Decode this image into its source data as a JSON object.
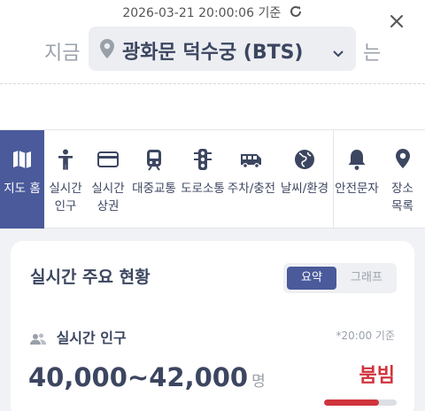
{
  "header": {
    "timestamp": "2026-03-21 20:00:06 기준",
    "location_prefix": "지금",
    "location_name": "광화문 덕수궁 (BTS)",
    "location_suffix": "는"
  },
  "nav": {
    "items": [
      {
        "label": "지도 홈",
        "icon": "map-icon",
        "active": true
      },
      {
        "label": "실시간\n인구",
        "icon": "person-icon"
      },
      {
        "label": "실시간\n상권",
        "icon": "credit-card-icon"
      },
      {
        "label": "대중교통",
        "icon": "subway-icon"
      },
      {
        "label": "도로소통",
        "icon": "traffic-light-icon"
      },
      {
        "label": "주차/충전",
        "icon": "bus-icon"
      },
      {
        "label": "날씨/환경",
        "icon": "globe-icon"
      },
      {
        "label": "안전문자",
        "icon": "bell-icon"
      },
      {
        "label": "장소\n목록",
        "icon": "location-pin-icon"
      }
    ]
  },
  "card": {
    "title": "실시간 주요 현황",
    "toggle": {
      "summary": "요약",
      "graph": "그래프",
      "selected": "요약"
    },
    "population": {
      "heading": "실시간 인구",
      "time": "*20:00 기준",
      "value": "40,000~42,000",
      "unit": "명",
      "status": "붐빔",
      "level": 0.75
    }
  },
  "colors": {
    "primary": "#4a5a9a",
    "text_dark": "#3c4660",
    "danger": "#d0343d",
    "muted": "#9aa0aa"
  }
}
